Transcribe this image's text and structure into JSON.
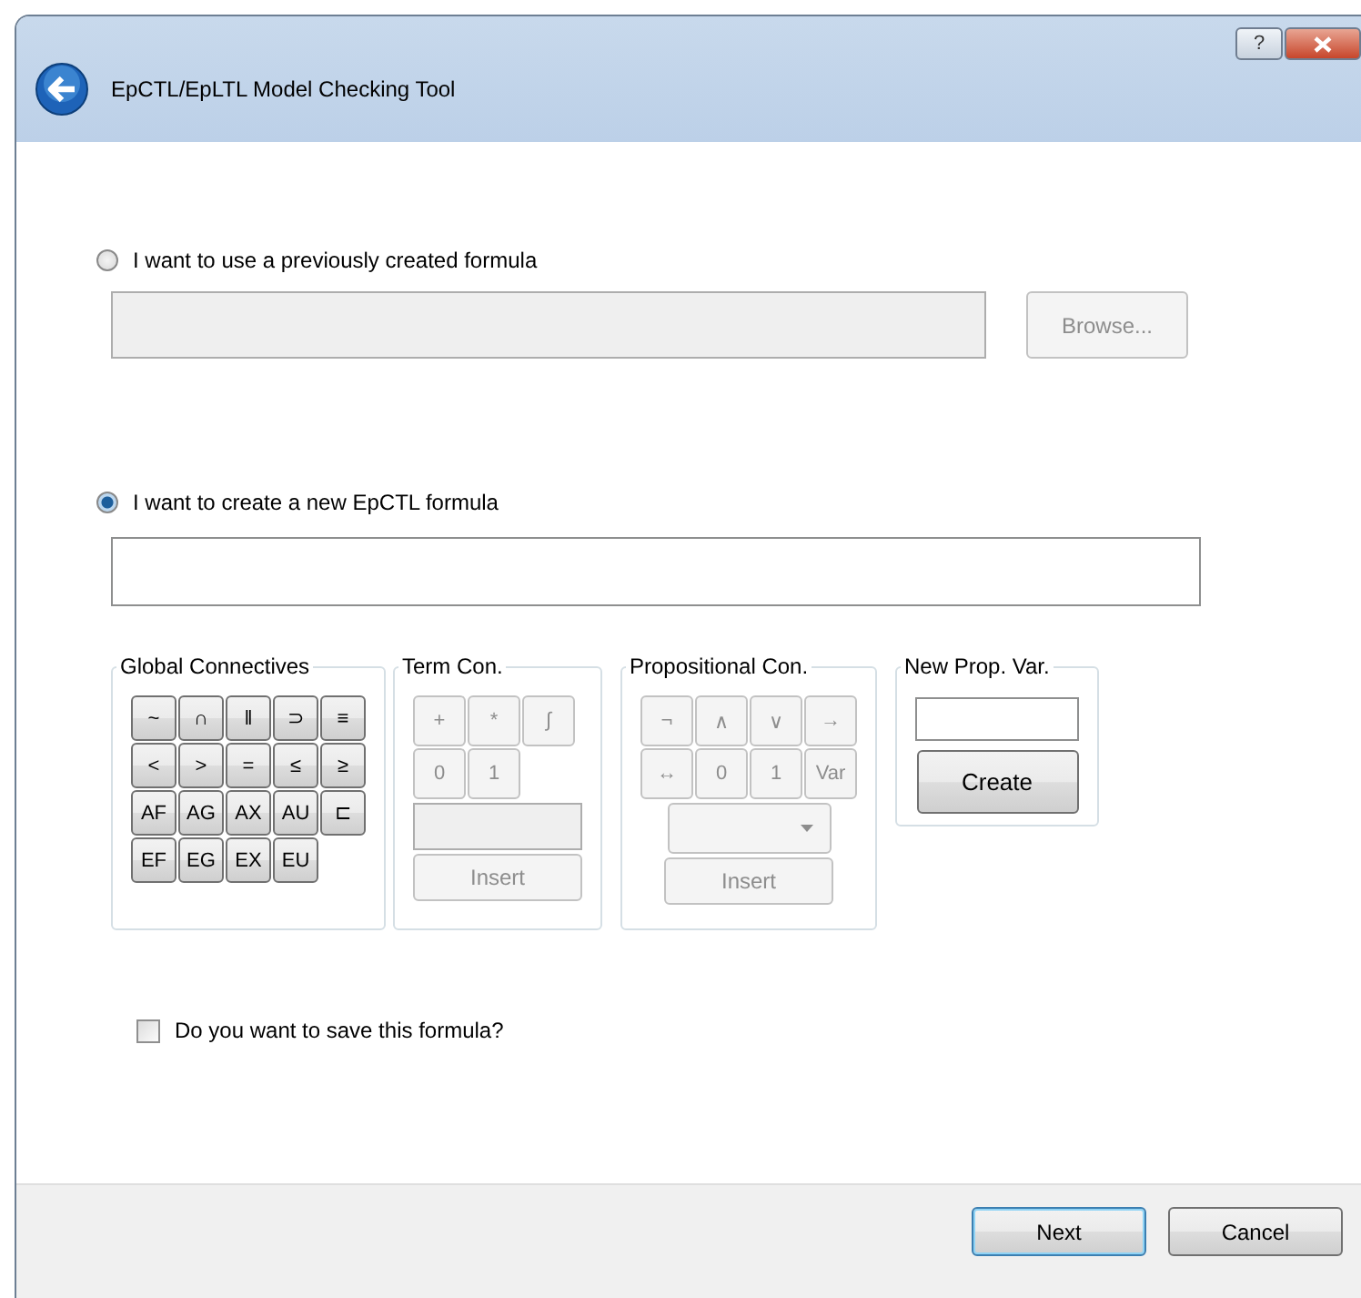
{
  "window": {
    "title": "EpCTL/EpLTL Model Checking Tool",
    "help_button": "?"
  },
  "options": [
    {
      "kind": "file",
      "label": "I want to use a previously created formula",
      "selected": false,
      "disabled": true,
      "button": "Browse..."
    },
    {
      "kind": "formula",
      "label": "I want to create a new EpCTL formula",
      "selected": true,
      "disabled": false
    }
  ],
  "groups": [
    {
      "title": "Global Connectives",
      "disabled": false,
      "rows": [
        [
          "~",
          "∩",
          "‖",
          "⊃",
          "≡"
        ],
        [
          "<",
          ">",
          "=",
          "≤",
          "≥"
        ],
        [
          "AF",
          "AG",
          "AX",
          "AU",
          "⊏"
        ],
        [
          "EF",
          "EG",
          "EX",
          "EU"
        ]
      ]
    },
    {
      "title": "Term Con.",
      "disabled": true,
      "rows": [
        [
          "+",
          "*",
          "∫"
        ],
        [
          "0",
          "1"
        ]
      ],
      "extras": [
        {
          "kind": "text_field"
        },
        {
          "kind": "button",
          "label": "Insert"
        }
      ]
    },
    {
      "title": "Propositional Con.",
      "disabled": true,
      "rows": [
        [
          "¬",
          "∧",
          "∨",
          "→"
        ],
        [
          "↔",
          "0",
          "1",
          "Var"
        ]
      ],
      "extras": [
        {
          "kind": "dropdown"
        },
        {
          "kind": "button",
          "label": "Insert"
        }
      ]
    },
    {
      "title": "New Prop. Var.",
      "disabled": false,
      "extras": [
        {
          "kind": "text_field"
        },
        {
          "kind": "button",
          "label": "Create"
        }
      ]
    }
  ],
  "save": {
    "label": "Do you want to save this formula?",
    "checked": false
  },
  "buttons": [
    {
      "label": "Next",
      "default": true
    },
    {
      "label": "Cancel",
      "default": false
    }
  ]
}
